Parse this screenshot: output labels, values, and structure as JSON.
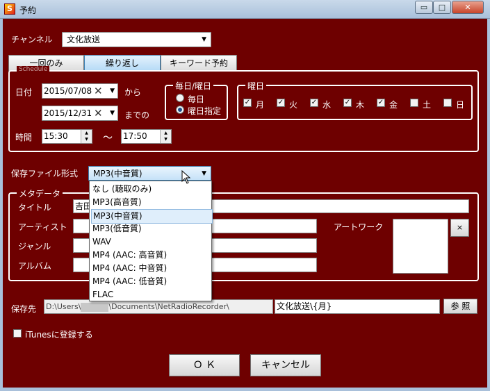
{
  "window": {
    "title": "予約",
    "app_icon_glyph": "S",
    "minimize": "▭",
    "maximize": "□",
    "close": "✕"
  },
  "channel": {
    "label": "チャンネル",
    "value": "文化放送"
  },
  "tabs": [
    {
      "label": "一回のみ"
    },
    {
      "label": "繰り返し",
      "active": true
    },
    {
      "label": "キーワード予約"
    }
  ],
  "schedule": {
    "legend": "Schedule",
    "date_label": "日付",
    "start_date": "2015/07/08",
    "end_date": "2015/12/31",
    "from_label": "から",
    "until_label": "までの",
    "time_label": "時間",
    "start_time": "15:30",
    "tilde": "〜",
    "end_time": "17:50",
    "clear_glyph": "✕",
    "dropdown_glyph": "▼",
    "spin_glyph_up": "▲",
    "spin_glyph_down": "▼"
  },
  "repeat_mode": {
    "legend": "毎日/曜日",
    "options": [
      {
        "label": "毎日",
        "selected": false
      },
      {
        "label": "曜日指定",
        "selected": true
      }
    ]
  },
  "weekdays": {
    "legend": "曜日",
    "check_glyph": "✓",
    "days": [
      {
        "label": "月",
        "checked": true
      },
      {
        "label": "火",
        "checked": true
      },
      {
        "label": "水",
        "checked": true
      },
      {
        "label": "木",
        "checked": true
      },
      {
        "label": "金",
        "checked": true
      },
      {
        "label": "土",
        "checked": false
      },
      {
        "label": "日",
        "checked": false
      }
    ]
  },
  "format": {
    "label": "保存ファイル形式",
    "value": "MP3(中音質)",
    "options": [
      "なし (聴取のみ)",
      "MP3(高音質)",
      "MP3(中音質)",
      "MP3(低音質)",
      "WAV",
      "MP4 (AAC: 高音質)",
      "MP4 (AAC: 中音質)",
      "MP4 (AAC: 低音質)",
      "FLAC"
    ],
    "selected_index": 2
  },
  "metadata": {
    "legend": "メタデータ",
    "title_label": "タイトル",
    "title_value": "吉田",
    "artist_label": "アーティスト",
    "genre_label": "ジャンル",
    "album_label": "アルバム",
    "artwork_label": "アートワーク",
    "artwork_clear": "×"
  },
  "save": {
    "label": "保存先",
    "path_prefix": "D:\\Users\\",
    "path_suffix": "\\Documents\\NetRadioRecorder\\",
    "filename": "文化放送\\{月}",
    "browse_label": "参 照"
  },
  "itunes": {
    "label": "iTunesに登録する",
    "checked": false
  },
  "buttons": {
    "ok": "Ｏ Ｋ",
    "cancel": "キャンセル"
  }
}
